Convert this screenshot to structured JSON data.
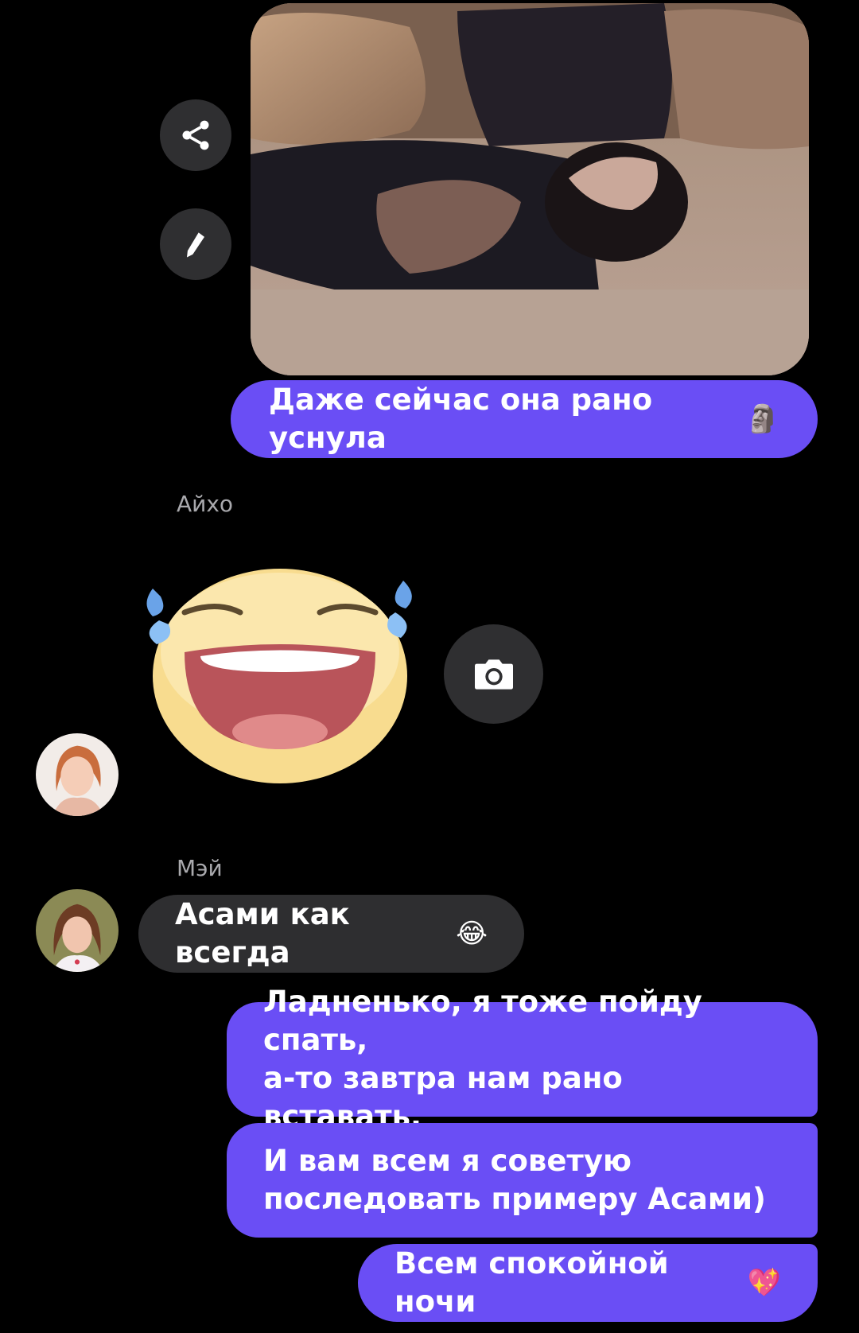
{
  "messages": {
    "m1_text": "Даже сейчас она рано уснула",
    "m1_emoji": "🗿",
    "sender_aiho": "Айхо",
    "sender_mei": "Мэй",
    "m2_text": "Асами как всегда",
    "m2_emoji": "😂",
    "m3_line1": "Ладненько, я тоже пойду спать,",
    "m3_line2": "а-то завтра нам рано вставать.",
    "m4_line1": "И вам всем я советую",
    "m4_line2": "последовать примеру Асами)",
    "m5_text": "Всем спокойной ночи",
    "m5_emoji": "💖"
  },
  "icons": {
    "share": "share-icon",
    "edit": "pencil-icon",
    "camera": "camera-icon"
  },
  "colors": {
    "my_bubble": "#6a4ef5",
    "their_bubble": "#2e2e30",
    "background": "#000000"
  }
}
